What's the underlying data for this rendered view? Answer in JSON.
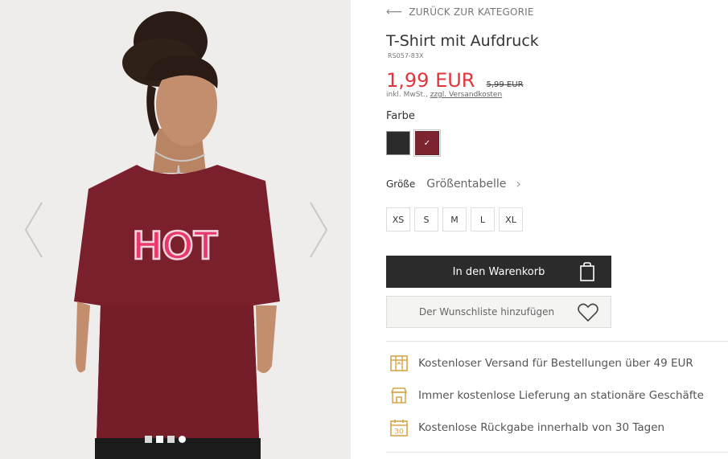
{
  "gallery": {
    "print_text": "HOT",
    "dot_count": 4,
    "active_dot": 2
  },
  "nav": {
    "back_label": "ZURÜCK ZUR KATEGORIE"
  },
  "product": {
    "title": "T-Shirt mit Aufdruck",
    "sku": "RS057-83X",
    "price": "1,99 EUR",
    "old_price": "5,99 EUR",
    "tax_text": "inkl. MwSt., ",
    "shipping_link": "zzgl. Versandkosten"
  },
  "color": {
    "label": "Farbe",
    "options": [
      {
        "name": "black",
        "hex": "#2b2b2b"
      },
      {
        "name": "burgundy",
        "hex": "#7d2430",
        "selected": true
      }
    ]
  },
  "size": {
    "label": "Größe",
    "table_link": "Größentabelle",
    "options": [
      "XS",
      "S",
      "M",
      "L",
      "XL"
    ]
  },
  "actions": {
    "cart_label": "In den Warenkorb",
    "wishlist_label": "Der Wunschliste hinzufügen"
  },
  "benefits": [
    {
      "icon": "shipping-box-icon",
      "text": "Kostenloser Versand für Bestellungen über 49 EUR"
    },
    {
      "icon": "store-icon",
      "text": "Immer kostenlose Lieferung an stationäre Geschäfte"
    },
    {
      "icon": "calendar-30-icon",
      "text": "Kostenlose Rückgabe innerhalb von 30 Tagen"
    }
  ],
  "colors": {
    "accent_price": "#e2343b",
    "benefit_icon": "#d9a54a",
    "button_dark": "#2b2b2b"
  }
}
